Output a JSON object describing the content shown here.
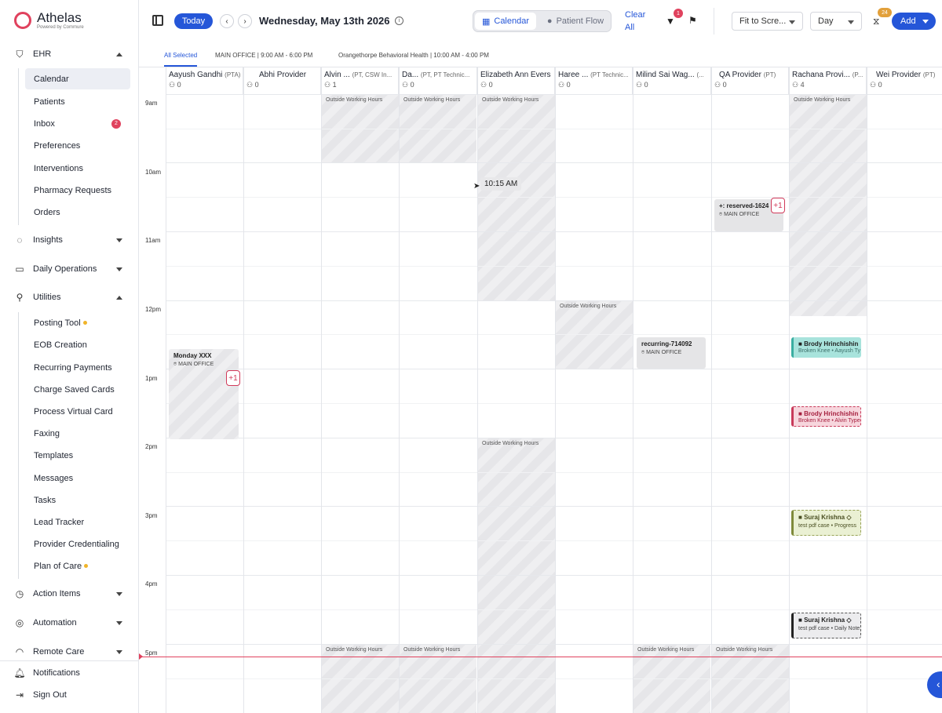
{
  "brand": {
    "name": "Athelas",
    "sub": "Powered by Commure"
  },
  "sidebar": {
    "ehr_label": "EHR",
    "ehr_items": [
      {
        "label": "Calendar",
        "active": true
      },
      {
        "label": "Patients"
      },
      {
        "label": "Inbox",
        "badge": "2"
      },
      {
        "label": "Preferences"
      },
      {
        "label": "Interventions"
      },
      {
        "label": "Pharmacy Requests"
      },
      {
        "label": "Orders"
      }
    ],
    "insights_label": "Insights",
    "daily_ops_label": "Daily Operations",
    "utilities_label": "Utilities",
    "utilities_items": [
      {
        "label": "Posting Tool",
        "dot": true
      },
      {
        "label": "EOB Creation"
      },
      {
        "label": "Recurring Payments"
      },
      {
        "label": "Charge Saved Cards"
      },
      {
        "label": "Process Virtual Card"
      },
      {
        "label": "Faxing"
      },
      {
        "label": "Templates"
      },
      {
        "label": "Messages"
      },
      {
        "label": "Tasks"
      },
      {
        "label": "Lead Tracker"
      },
      {
        "label": "Provider Credentialing"
      },
      {
        "label": "Plan of Care",
        "dot": true
      }
    ],
    "action_items_label": "Action Items",
    "automation_label": "Automation",
    "remote_care_label": "Remote Care",
    "notifications_label": "Notifications",
    "sign_out_label": "Sign Out"
  },
  "toolbar": {
    "today_label": "Today",
    "date_title": "Wednesday, May 13th 2026",
    "view_calendar": "Calendar",
    "view_patient_flow": "Patient Flow",
    "clear_all": "Clear All",
    "filter_badge": "1",
    "fit_select": "Fit to Scre...",
    "range_select": "Day",
    "hourglass_badge": "24",
    "add_label": "Add"
  },
  "locations": [
    {
      "label": "All Selected",
      "active": true
    },
    {
      "label": "MAIN OFFICE | 9:00 AM - 6:00 PM"
    },
    {
      "label": "Orangethorpe Behavioral Health | 10:00 AM - 4:00 PM"
    }
  ],
  "providers": [
    {
      "name": "Aayush Gandhi",
      "role": "(PTA)",
      "count": "0"
    },
    {
      "name": "Abhi Provider",
      "role": "",
      "count": "0"
    },
    {
      "name": "Alvin ...",
      "role": "(PT, CSW In...",
      "count": "1"
    },
    {
      "name": "Da...",
      "role": "(PT, PT Technic...",
      "count": "0"
    },
    {
      "name": "Elizabeth Ann Evers",
      "role": "",
      "count": "0"
    },
    {
      "name": "Haree ...",
      "role": "(PT Technic...",
      "count": "0"
    },
    {
      "name": "Milind Sai Wag...",
      "role": "(...",
      "count": "0"
    },
    {
      "name": "QA Provider",
      "role": "(PT)",
      "count": "0"
    },
    {
      "name": "Rachana Provi...",
      "role": "(P...",
      "count": "4"
    },
    {
      "name": "Wei Provider",
      "role": "(PT)",
      "count": "0"
    }
  ],
  "time_labels": [
    "9am",
    "10am",
    "11am",
    "12pm",
    "1pm",
    "2pm",
    "3pm",
    "4pm",
    "5pm"
  ],
  "outside_label": "Outside Working Hours",
  "hover_time": "10:15 AM",
  "events": {
    "monday": {
      "title": "Monday XXX",
      "sub": "MAIN OFFICE",
      "more": "+1"
    },
    "reserved": {
      "title": "+: reserved-1624",
      "sub": "MAIN OFFICE",
      "more": "+1"
    },
    "recurring": {
      "title": "recurring-714092",
      "sub": "MAIN OFFICE"
    },
    "brody1": {
      "title": "Brody Hrinchishin",
      "sub": "Broken Knee • Aayush Ty"
    },
    "brody2": {
      "title": "Brody Hrinchishin",
      "sub": "Broken Knee • Alvin Type"
    },
    "suraj1": {
      "title": "Suraj Krishna",
      "sub": "test pdf case • Progress"
    },
    "suraj2": {
      "title": "Suraj Krishna",
      "sub": "test pdf case • Daily Note"
    }
  },
  "colors": {
    "accent": "#2556d8",
    "brand": "#e0425e",
    "now_line": "#e0425e"
  }
}
